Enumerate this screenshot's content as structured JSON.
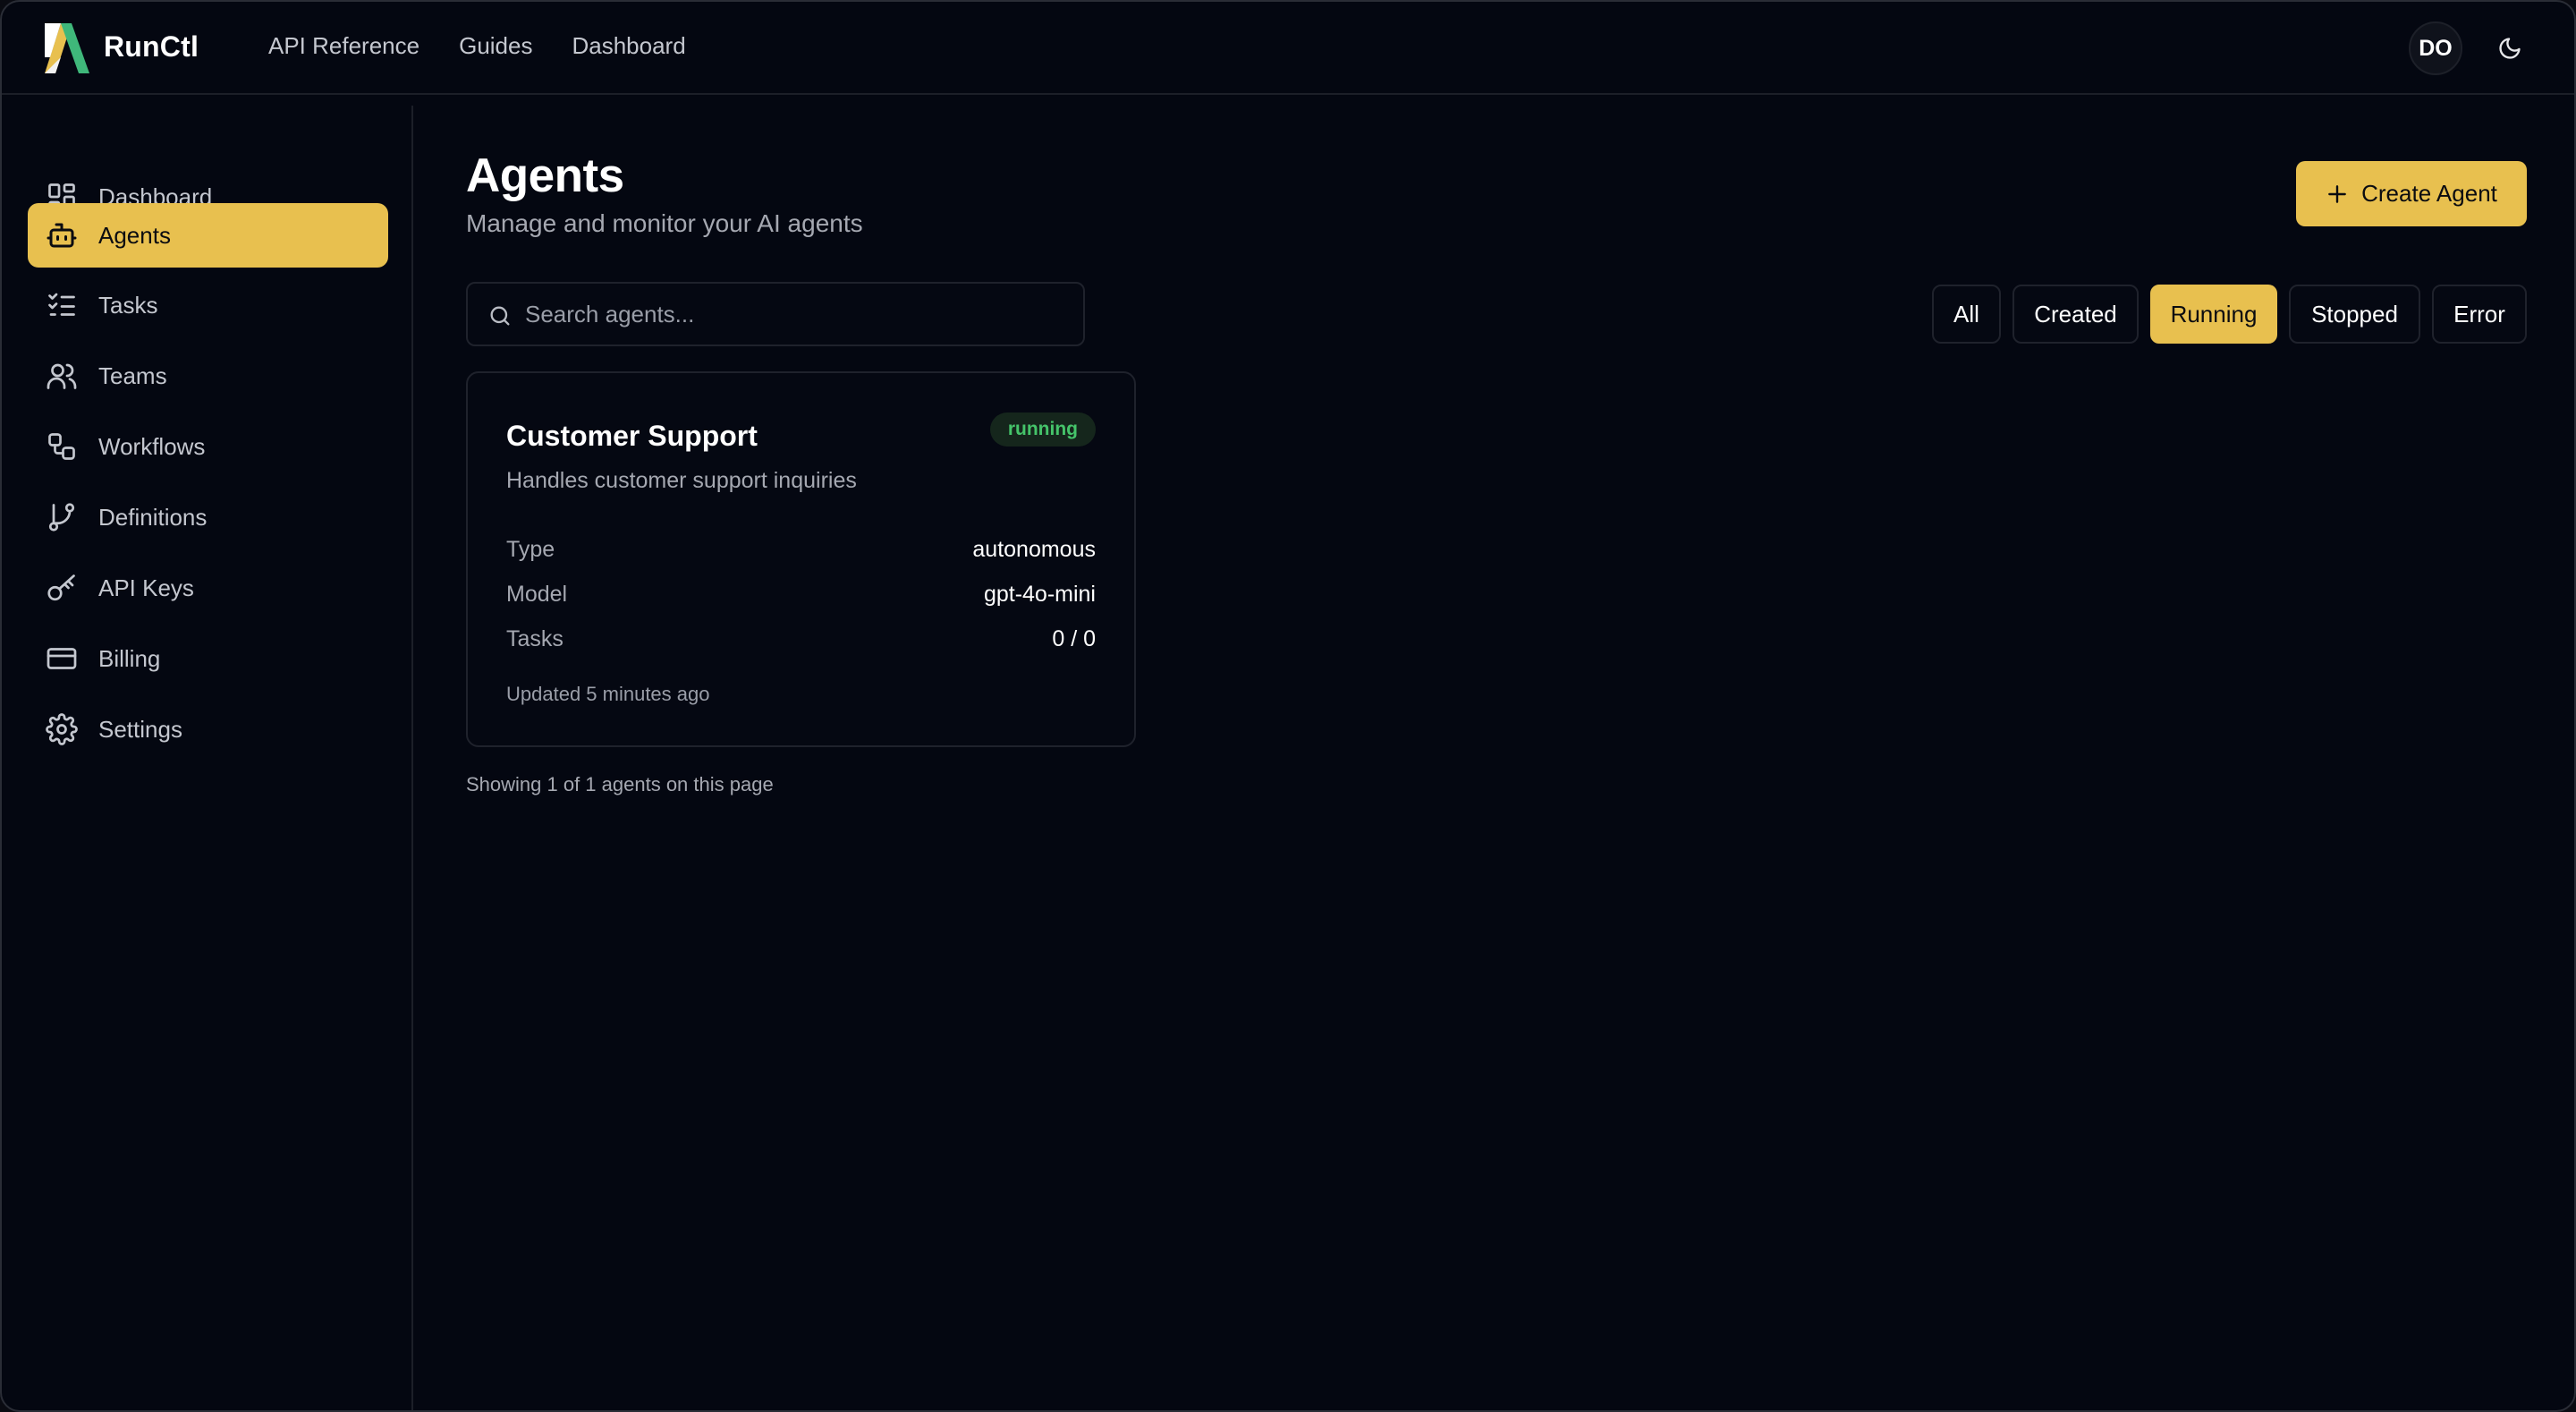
{
  "app": {
    "brand": "RunCtl",
    "top_nav": [
      {
        "label": "API Reference"
      },
      {
        "label": "Guides"
      },
      {
        "label": "Dashboard"
      }
    ],
    "avatar_initials": "DO",
    "theme_icon": "moon-icon",
    "colors": {
      "accent": "#e8c04f",
      "background": "#040711",
      "status_running": "#45c46a"
    }
  },
  "sidebar": {
    "items": [
      {
        "label": "Dashboard",
        "icon": "dashboard-icon"
      },
      {
        "label": "Agents",
        "icon": "bot-icon",
        "active": true
      },
      {
        "label": "Tasks",
        "icon": "list-checks-icon"
      },
      {
        "label": "Teams",
        "icon": "users-icon"
      },
      {
        "label": "Workflows",
        "icon": "workflow-icon"
      },
      {
        "label": "Definitions",
        "icon": "git-branch-icon"
      },
      {
        "label": "API Keys",
        "icon": "key-icon"
      },
      {
        "label": "Billing",
        "icon": "credit-card-icon"
      },
      {
        "label": "Settings",
        "icon": "gear-icon"
      }
    ]
  },
  "main": {
    "title": "Agents",
    "subtitle": "Manage and monitor your AI agents",
    "create_button": "Create Agent",
    "search": {
      "placeholder": "Search agents...",
      "value": ""
    },
    "filters": [
      {
        "label": "All"
      },
      {
        "label": "Created"
      },
      {
        "label": "Running",
        "active": true
      },
      {
        "label": "Stopped"
      },
      {
        "label": "Error"
      }
    ],
    "agents": [
      {
        "name": "Customer Support",
        "status": "running",
        "description": "Handles customer support inquiries",
        "fields": [
          {
            "key": "Type",
            "value": "autonomous"
          },
          {
            "key": "Model",
            "value": "gpt-4o-mini"
          },
          {
            "key": "Tasks",
            "value": "0 / 0"
          }
        ],
        "updated": "Updated 5 minutes ago"
      }
    ],
    "showing": "Showing 1 of 1 agents on this page"
  }
}
